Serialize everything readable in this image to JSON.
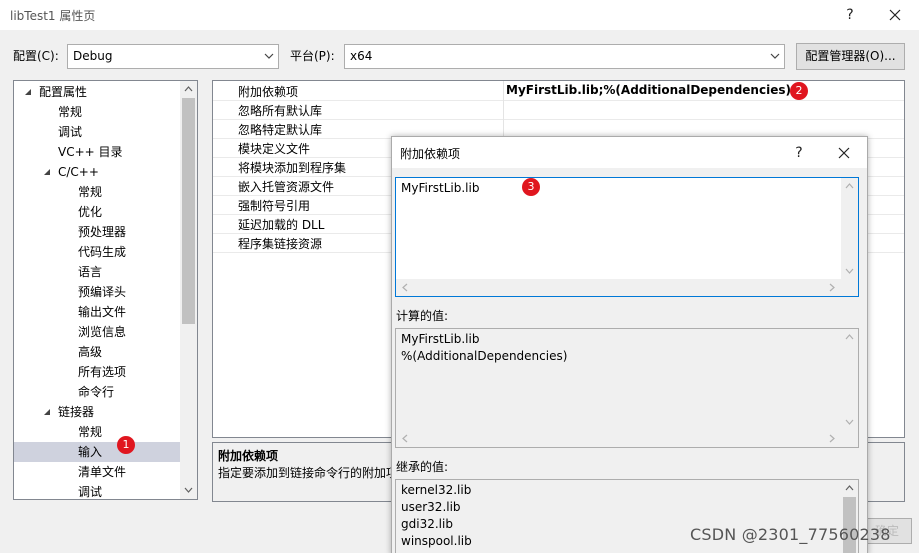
{
  "window": {
    "title": "libTest1 属性页",
    "help": "?",
    "close": "✕"
  },
  "toolbar": {
    "config_label": "配置(C):",
    "config_value": "Debug",
    "platform_label": "平台(P):",
    "platform_value": "x64",
    "manager_button": "配置管理器(O)..."
  },
  "tree": {
    "items": [
      {
        "label": "配置属性",
        "level": 0,
        "expanded": true
      },
      {
        "label": "常规",
        "level": 1
      },
      {
        "label": "调试",
        "level": 1
      },
      {
        "label": "VC++ 目录",
        "level": 1
      },
      {
        "label": "C/C++",
        "level": 1,
        "expanded": true
      },
      {
        "label": "常规",
        "level": 2
      },
      {
        "label": "优化",
        "level": 2
      },
      {
        "label": "预处理器",
        "level": 2
      },
      {
        "label": "代码生成",
        "level": 2
      },
      {
        "label": "语言",
        "level": 2
      },
      {
        "label": "预编译头",
        "level": 2
      },
      {
        "label": "输出文件",
        "level": 2
      },
      {
        "label": "浏览信息",
        "level": 2
      },
      {
        "label": "高级",
        "level": 2
      },
      {
        "label": "所有选项",
        "level": 2
      },
      {
        "label": "命令行",
        "level": 2
      },
      {
        "label": "链接器",
        "level": 1,
        "expanded": true
      },
      {
        "label": "常规",
        "level": 2
      },
      {
        "label": "输入",
        "level": 2,
        "selected": true
      },
      {
        "label": "清单文件",
        "level": 2
      },
      {
        "label": "调试",
        "level": 2
      }
    ]
  },
  "grid": {
    "rows": [
      {
        "name": "附加依赖项",
        "value": "MyFirstLib.lib;%(AdditionalDependencies)"
      },
      {
        "name": "忽略所有默认库",
        "value": ""
      },
      {
        "name": "忽略特定默认库",
        "value": ""
      },
      {
        "name": "模块定义文件",
        "value": ""
      },
      {
        "name": "将模块添加到程序集",
        "value": ""
      },
      {
        "name": "嵌入托管资源文件",
        "value": ""
      },
      {
        "name": "强制符号引用",
        "value": ""
      },
      {
        "name": "延迟加载的 DLL",
        "value": ""
      },
      {
        "name": "程序集链接资源",
        "value": ""
      }
    ]
  },
  "description": {
    "title": "附加依赖项",
    "text": "指定要添加到链接命令行的附加项"
  },
  "dialog": {
    "title": "附加依赖项",
    "help": "?",
    "close": "✕",
    "edit_lines": [
      "MyFirstLib.lib"
    ],
    "computed_label": "计算的值:",
    "computed_lines": [
      "MyFirstLib.lib",
      "%(AdditionalDependencies)"
    ],
    "inherited_label": "继承的值:",
    "inherited_lines": [
      "kernel32.lib",
      "user32.lib",
      "gdi32.lib",
      "winspool.lib"
    ]
  },
  "badges": {
    "b1": "1",
    "b2": "2",
    "b3": "3"
  },
  "watermark": "CSDN @2301_77560238",
  "ghost_button": "确定",
  "colors": {
    "badge": "#e0161f",
    "selection": "#cfd2de",
    "focus_border": "#0078d7"
  }
}
